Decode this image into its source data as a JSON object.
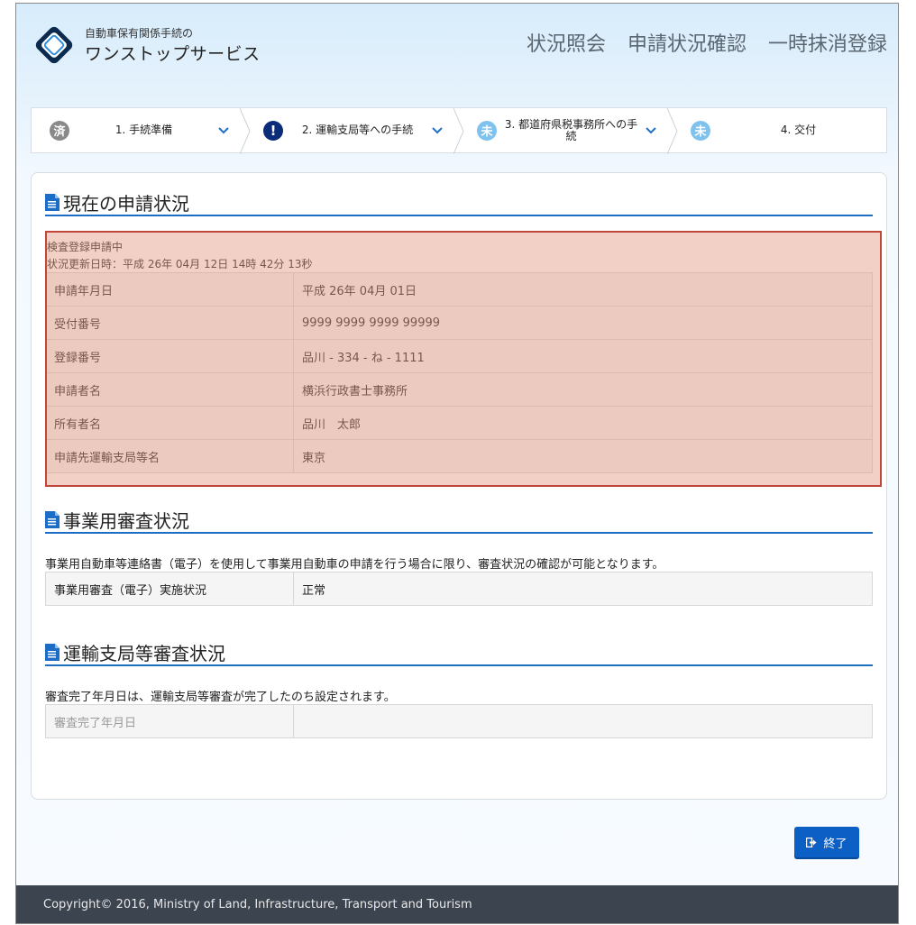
{
  "header": {
    "brand_top": "自動車保有関係手続の",
    "brand_main": "ワンストップサービス",
    "nav": [
      "状況照会",
      "申請状況確認",
      "一時抹消登録"
    ]
  },
  "stepper": [
    {
      "badge": "済",
      "label": "1. 手続準備",
      "state": "done"
    },
    {
      "badge": "!",
      "label": "2. 運輸支局等への手続",
      "state": "alert"
    },
    {
      "badge": "未",
      "label": "3. 都道府県税事務所への手続",
      "state": "todo"
    },
    {
      "badge": "未",
      "label": "4. 交付",
      "state": "todo"
    }
  ],
  "current": {
    "title": "現在の申請状況",
    "status": "検査登録申請中",
    "updated": "状況更新日時：平成 26年 04月 12日 14時 42分 13秒",
    "rows": [
      {
        "k": "申請年月日",
        "v": "平成 26年 04月 01日"
      },
      {
        "k": "受付番号",
        "v": "9999 9999 9999 99999"
      },
      {
        "k": "登録番号",
        "v": "品川 - 334 - ね - 1111"
      },
      {
        "k": "申請者名",
        "v": "横浜行政書士事務所"
      },
      {
        "k": "所有者名",
        "v": "品川　太郎"
      },
      {
        "k": "申請先運輸支局等名",
        "v": "東京"
      }
    ]
  },
  "business": {
    "title": "事業用審査状況",
    "note": "事業用自動車等連絡書（電子）を使用して事業用自動車の申請を行う場合に限り、審査状況の確認が可能となります。",
    "row": {
      "k": "事業用審査（電子）実施状況",
      "v": "正常"
    }
  },
  "transport": {
    "title": "運輸支局等審査状況",
    "note": "審査完了年月日は、運輸支局等審査が完了したのち設定されます。",
    "row": {
      "k": "審査完了年月日",
      "v": ""
    }
  },
  "exit_label": "終了",
  "footer": "Copyright© 2016, Ministry of Land, Infrastructure, Transport and Tourism",
  "colors": {
    "accent": "#1e6dc5",
    "button": "#0c5fc4",
    "highlight_border": "#c0453a",
    "footer": "#3c4450"
  }
}
